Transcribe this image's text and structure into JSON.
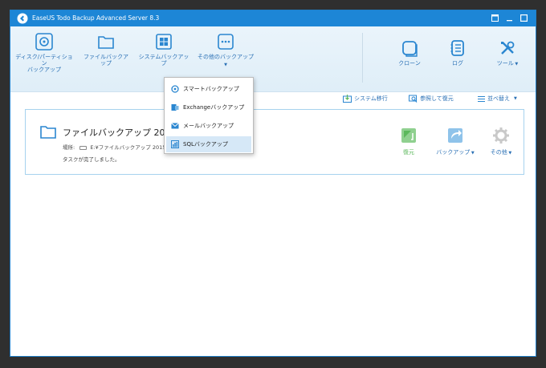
{
  "window": {
    "title": "EaseUS Todo Backup Advanced Server 8.3",
    "controls": [
      "restore-icon",
      "minimize-icon",
      "close-icon"
    ]
  },
  "toolbar": {
    "disk_partition_backup": "ディスク/パーティション\nバックアップ",
    "file_backup": "ファイルバックアップ",
    "system_backup": "システムバックアップ",
    "other_backup": "その他のバックアップ",
    "clone": "クローン",
    "log": "ログ",
    "tools": "ツール"
  },
  "actions": {
    "system_migration": "システム移行",
    "browse_restore": "参照して復元",
    "sort": "並べ替え"
  },
  "backup_task": {
    "title": "ファイルバックアップ 2015-06",
    "location_label": "場所:",
    "location_value": "E:¥ファイルバックアップ 2015-0",
    "status": "タスクが完了しました。",
    "restore": "復元",
    "backup": "バックアップ",
    "other": "その他"
  },
  "dropdown": {
    "items": [
      "スマートバックアップ",
      "Exchangeバックアップ",
      "メールバックアップ",
      "SQLバックアップ"
    ],
    "selected": "SQLバックアップ"
  },
  "colors": {
    "accent": "#1d86d6",
    "link": "#2a70b5",
    "restore_green": "#5cb85c"
  }
}
